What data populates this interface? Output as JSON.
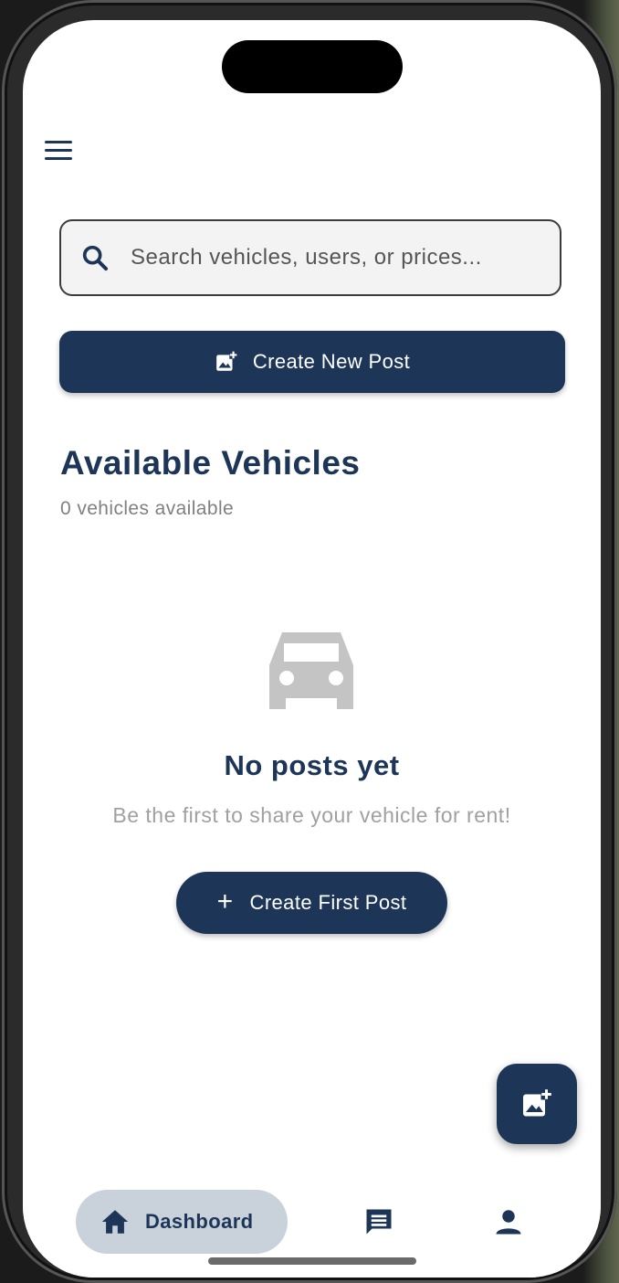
{
  "header": {
    "menu_icon": "hamburger-menu-icon"
  },
  "search": {
    "placeholder": "Search vehicles, users, or prices...",
    "value": "",
    "icon": "search-icon"
  },
  "actions": {
    "create_new_post_label": "Create New Post",
    "create_new_post_icon": "add-photo-icon"
  },
  "vehicles": {
    "title": "Available Vehicles",
    "count_text": "0 vehicles available"
  },
  "empty_state": {
    "icon": "car-icon",
    "title": "No posts yet",
    "message": "Be the first to share your vehicle for rent!",
    "button_label": "Create First Post",
    "button_icon": "plus-icon"
  },
  "fab": {
    "icon": "add-photo-icon"
  },
  "bottom_nav": {
    "items": [
      {
        "label": "Dashboard",
        "icon": "home-icon",
        "active": true
      },
      {
        "label": "",
        "icon": "chat-icon",
        "active": false
      },
      {
        "label": "",
        "icon": "person-icon",
        "active": false
      }
    ]
  },
  "colors": {
    "primary": "#1d3557",
    "active_nav_bg": "#c9d1da",
    "muted_text": "#808080",
    "empty_icon": "#c4c4c4",
    "search_bg": "#f3f3f3"
  }
}
